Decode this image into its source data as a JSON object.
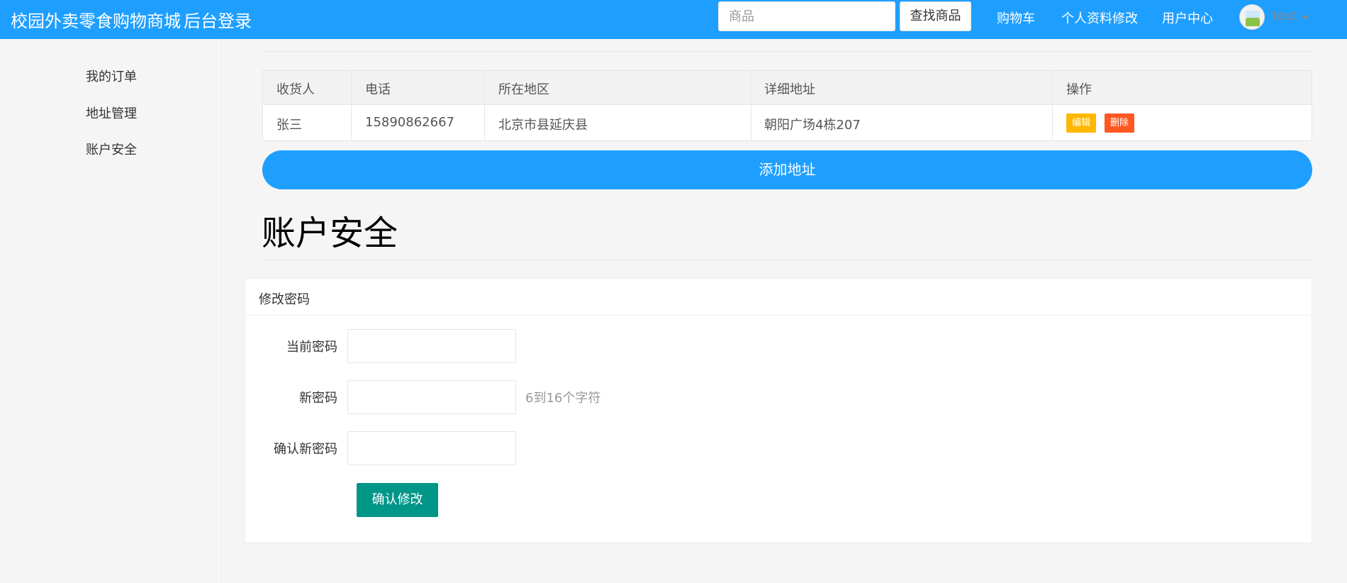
{
  "header": {
    "brand": "校园外卖零食购物商城",
    "admin_login": "后台登录",
    "search_placeholder": "商品",
    "search_button": "查找商品",
    "nav": [
      "购物车",
      "个人资料修改",
      "用户中心"
    ],
    "username": "test",
    "colors": {
      "header_bg": "#1e9fff"
    }
  },
  "sidebar": {
    "items": [
      {
        "label": "我的订单"
      },
      {
        "label": "地址管理"
      },
      {
        "label": "账户安全"
      }
    ]
  },
  "address_table": {
    "columns": [
      "收货人",
      "电话",
      "所在地区",
      "详细地址",
      "操作"
    ],
    "rows": [
      {
        "name": "张三",
        "phone": "15890862667",
        "region": "北京市县延庆县",
        "address": "朝阳广场4栋207",
        "edit_label": "编辑",
        "delete_label": "删除"
      }
    ],
    "add_button": "添加地址"
  },
  "security": {
    "title": "账户安全",
    "card_title": "修改密码",
    "fields": [
      {
        "label": "当前密码"
      },
      {
        "label": "新密码",
        "hint": "6到16个字符"
      },
      {
        "label": "确认新密码"
      }
    ],
    "submit": "确认修改"
  }
}
